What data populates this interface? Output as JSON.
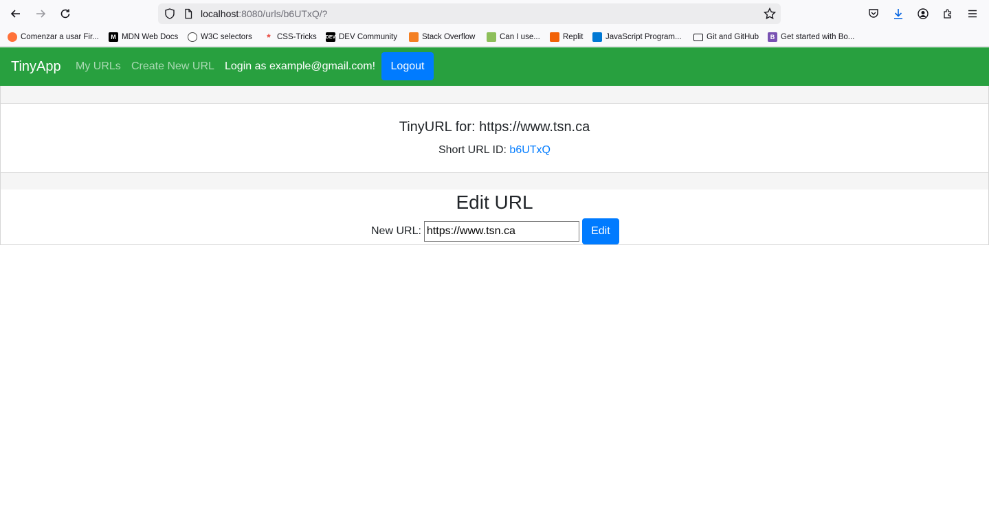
{
  "browser": {
    "url_host": "localhost",
    "url_rest": ":8080/urls/b6UTxQ/?",
    "bookmarks": [
      {
        "label": "Comenzar a usar Fir...",
        "icon": "firefox-icon"
      },
      {
        "label": "MDN Web Docs",
        "icon": "mdn-icon"
      },
      {
        "label": "W3C selectors",
        "icon": "globe-icon"
      },
      {
        "label": "CSS-Tricks",
        "icon": "css-tricks-icon"
      },
      {
        "label": "DEV Community",
        "icon": "dev-icon"
      },
      {
        "label": "Stack Overflow",
        "icon": "stackoverflow-icon"
      },
      {
        "label": "Can I use...",
        "icon": "caniuse-icon"
      },
      {
        "label": "Replit",
        "icon": "replit-icon"
      },
      {
        "label": "JavaScript Program...",
        "icon": "vscode-icon"
      },
      {
        "label": "Git and GitHub",
        "icon": "folder-icon"
      },
      {
        "label": "Get started with Bo...",
        "icon": "bootstrap-icon"
      }
    ]
  },
  "navbar": {
    "brand": "TinyApp",
    "my_urls": "My URLs",
    "create_new": "Create New URL",
    "login_text": "Login as example@gmail.com!",
    "logout": "Logout",
    "bg_color": "#28a03f"
  },
  "card": {
    "title": "TinyURL for: https://www.tsn.ca",
    "short_label": "Short URL ID: ",
    "short_id": "b6UTxQ",
    "edit_title": "Edit URL",
    "new_url_label": "New URL:",
    "new_url_value": "https://www.tsn.ca",
    "edit_button": "Edit"
  }
}
